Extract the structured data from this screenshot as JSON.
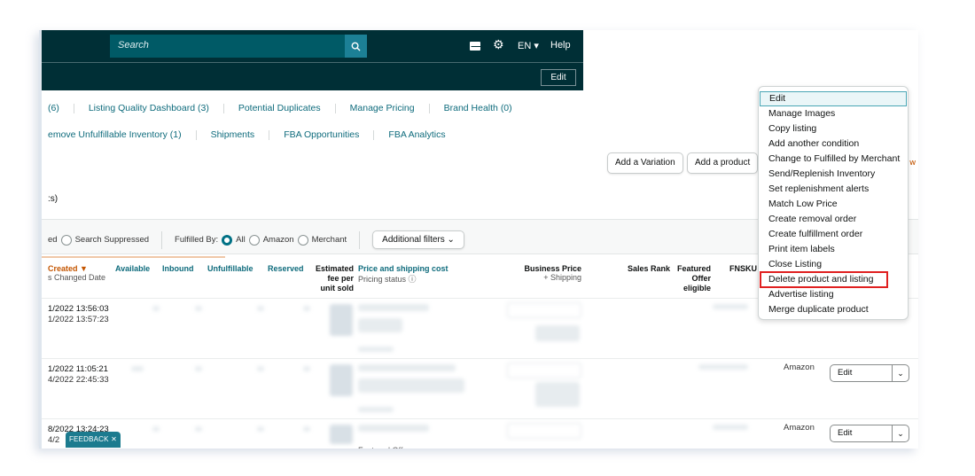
{
  "header": {
    "search_placeholder": "Search",
    "search_icon": "search-icon",
    "mail_icon": "mail-icon",
    "gear_icon": "gear-icon",
    "language": "EN ▾",
    "help": "Help",
    "edit_label": "Edit"
  },
  "nav": {
    "row1": [
      {
        "label": "(6)"
      },
      {
        "label": "Listing Quality Dashboard (3)"
      },
      {
        "label": "Potential Duplicates"
      },
      {
        "label": "Manage Pricing"
      },
      {
        "label": "Brand Health (0)"
      }
    ],
    "row2": [
      {
        "label": "emove Unfulfillable Inventory (1)"
      },
      {
        "label": "Shipments"
      },
      {
        "label": "FBA Opportunities"
      },
      {
        "label": "FBA Analytics"
      }
    ]
  },
  "actions": {
    "add_variation": "Add a Variation",
    "add_product": "Add a product",
    "view_fragment": "w"
  },
  "count_text": ":s)",
  "filters": {
    "status_fragment": "ed",
    "search_suppressed": "Search Suppressed",
    "fulfilled_by_label": "Fulfilled By:",
    "options": [
      "All",
      "Amazon",
      "Merchant"
    ],
    "selected": "All",
    "additional_filters": "Additional filters ⌄"
  },
  "table": {
    "columns": {
      "created": "Created ▼",
      "changed": "s Changed Date",
      "available": "Available",
      "inbound": "Inbound",
      "unfulfillable": "Unfulfillable",
      "reserved": "Reserved",
      "fee_line1": "Estimated",
      "fee_line2": "fee per",
      "fee_line3": "unit sold",
      "price": "Price and shipping cost",
      "pricing_status": "Pricing status ⓘ",
      "business_price": "Business Price",
      "plus_shipping": "+ Shipping",
      "sales_rank": "Sales Rank",
      "featured_line1": "Featured",
      "featured_line2": "Offer",
      "featured_line3": "eligible",
      "fnsku": "FNSKU"
    },
    "rows": [
      {
        "created": "1/2022 13:56:03",
        "changed": "1/2022 13:57:23",
        "fulfilled": "",
        "edit": ""
      },
      {
        "created": "1/2022 11:05:21",
        "changed": "4/2022 22:45:33",
        "fulfilled": "Amazon",
        "edit": "Edit"
      },
      {
        "created": "8/2022 13:24:23",
        "changed": "4/2",
        "fulfilled": "Amazon",
        "edit": "Edit"
      }
    ],
    "partial_text": "Featured Offer: --"
  },
  "feedback": "FEEDBACK ✕",
  "menu": {
    "items": [
      {
        "label": "Edit",
        "state": "active"
      },
      {
        "label": "Manage Images"
      },
      {
        "label": "Copy listing"
      },
      {
        "label": "Add another condition"
      },
      {
        "label": "Change to Fulfilled by Merchant"
      },
      {
        "label": "Send/Replenish Inventory"
      },
      {
        "label": "Set replenishment alerts"
      },
      {
        "label": "Match Low Price"
      },
      {
        "label": "Create removal order"
      },
      {
        "label": "Create fulfillment order"
      },
      {
        "label": "Print item labels"
      },
      {
        "label": "Close Listing"
      },
      {
        "label": "Delete product and listing",
        "state": "highlighted"
      },
      {
        "label": "Advertise listing"
      },
      {
        "label": "Merge duplicate product"
      }
    ]
  },
  "colors": {
    "header_bg": "#002f36",
    "search_bg": "#005a66",
    "link": "#0e6b7c",
    "sort_active": "#c45500",
    "highlight_box": "#e02020"
  }
}
